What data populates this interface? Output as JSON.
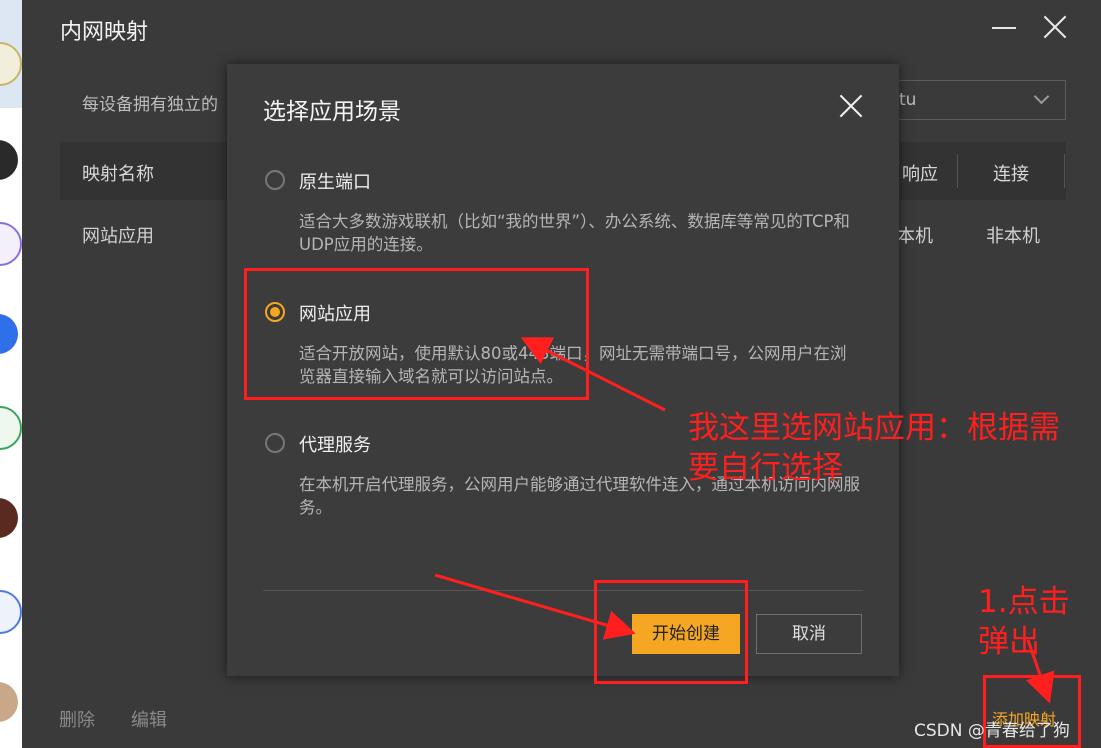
{
  "window": {
    "title": "内网映射",
    "info_text": "每设备拥有独立的",
    "select_value": "tu",
    "table": {
      "headers": [
        "映射名称",
        "响应",
        "连接"
      ],
      "rows": [
        [
          "网站应用",
          "本机",
          "非本机"
        ]
      ]
    },
    "footer": {
      "delete": "删除",
      "edit": "编辑",
      "add": "添加映射"
    }
  },
  "dialog": {
    "title": "选择应用场景",
    "options": [
      {
        "label": "原生端口",
        "desc": "适合大多数游戏联机（比如“我的世界”）、办公系统、数据库等常见的TCP和UDP应用的连接。",
        "selected": false
      },
      {
        "label": "网站应用",
        "desc": "适合开放网站，使用默认80或443端口，网址无需带端口号，公网用户在浏览器直接输入域名就可以访问站点。",
        "selected": true
      },
      {
        "label": "代理服务",
        "desc": "在本机开启代理服务，公网用户能够通过代理软件连入，通过本机访问内网服务。",
        "selected": false
      }
    ],
    "primary_button": "开始创建",
    "cancel_button": "取消"
  },
  "annotations": {
    "note_select": "我这里选网站应用：根据需要自行选择",
    "note_click": "1.点击弹出",
    "color": "#ff1f1f"
  },
  "watermark": "CSDN @青春给了狗",
  "colors": {
    "accent": "#f5a623",
    "background": "#3a3a3a",
    "dialog": "#3c3c3c"
  }
}
